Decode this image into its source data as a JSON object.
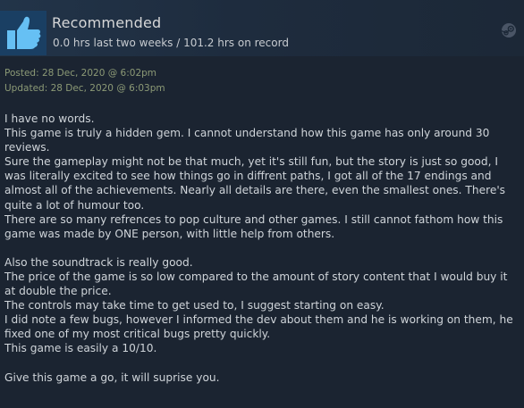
{
  "review": {
    "recommendation": "Recommended",
    "hours": "0.0 hrs last two weeks / 101.2 hrs on record",
    "posted": "Posted: 28 Dec, 2020 @ 6:02pm",
    "updated": "Updated: 28 Dec, 2020 @ 6:03pm",
    "paragraphs": {
      "p1": "I have no words.",
      "p2": "This game is truly a hidden gem. I cannot understand how this game has only around 30 reviews.",
      "p3": "Sure the gameplay might not be that much, yet it's still fun, but the story is just so good, I was literally excited to see how things go in diffrent paths, I got all of the 17 endings and almost all of the achievements. Nearly all details are there, even the smallest ones. There's quite a lot of humour too.",
      "p4": "There are so many refrences to pop culture and other games. I still cannot fathom how this game was made by ONE person, with little help from others.",
      "p5": "Also the soundtrack is really good.",
      "p6": "The price of the game is so low compared to the amount of story content that I would buy it at double the price.",
      "p7": "The controls may take time to get used to, I suggest starting on easy.",
      "p8": "I did note a few bugs, however I informed the dev about them and he is working on them, he fixed one of my most critical bugs pretty quickly.",
      "p9": "This game is easily a 10/10.",
      "p10": "Give this game a go, it will suprise you."
    }
  },
  "icons": {
    "thumb": "thumbs-up-icon",
    "platform": "steam-icon"
  },
  "colors": {
    "thumb_bg": "#1a3f63",
    "thumb": "#66c0f4",
    "date_text": "#8c9a76",
    "body_text": "#cfd4d9"
  }
}
